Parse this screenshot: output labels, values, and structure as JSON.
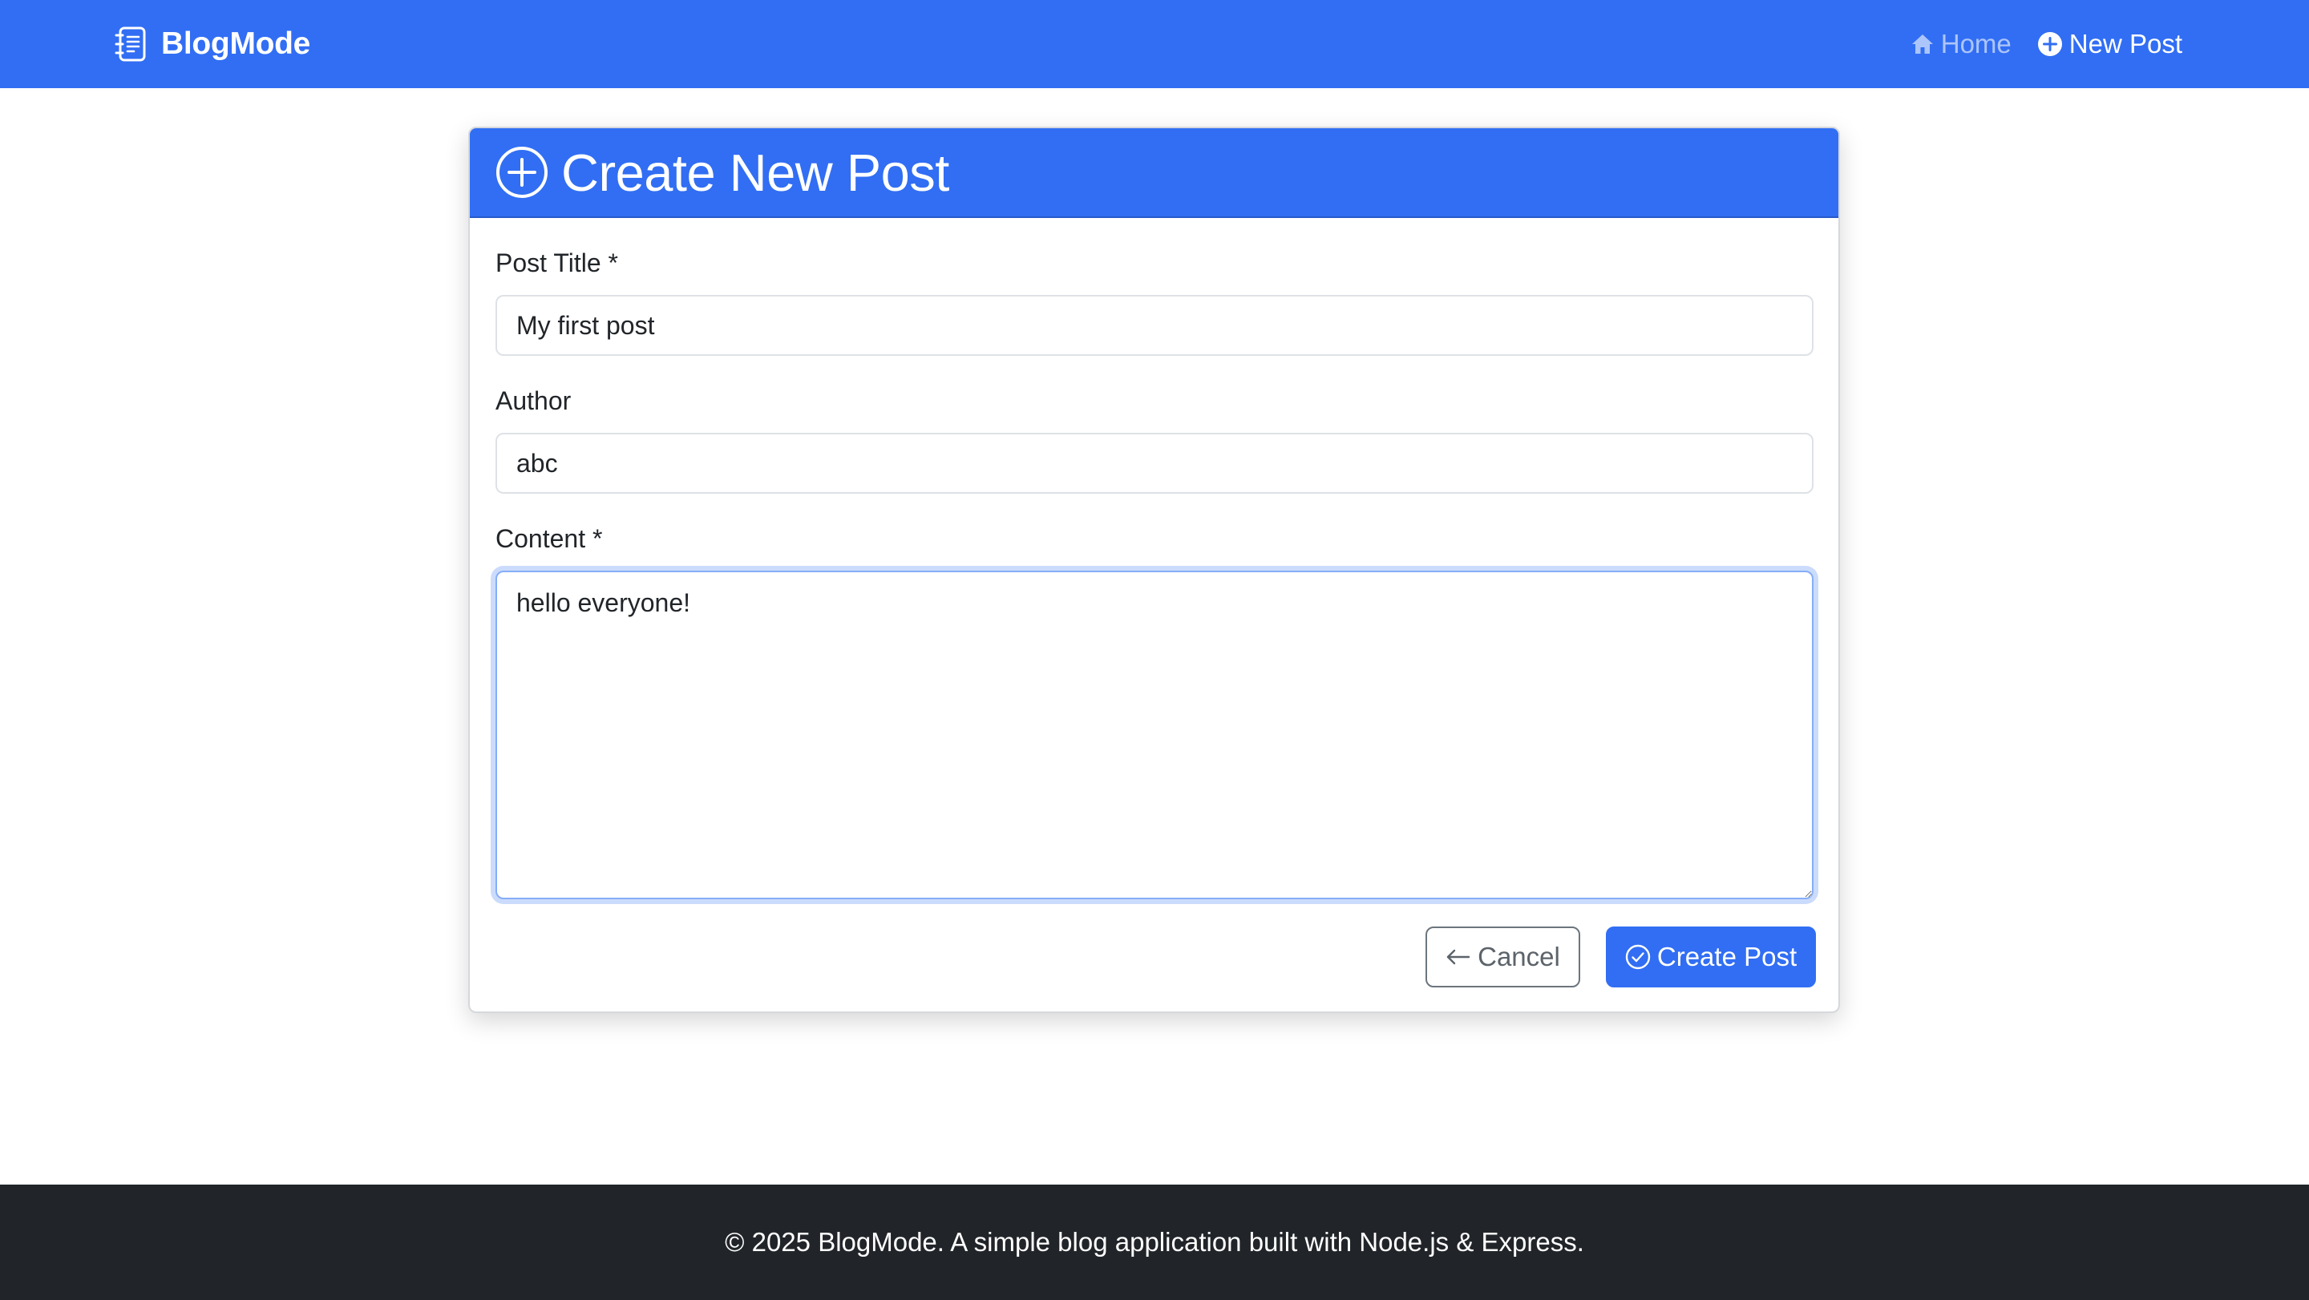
{
  "navbar": {
    "brand": "BlogMode",
    "brand_icon": "journal-text-icon",
    "links": [
      {
        "label": "Home",
        "icon": "house-icon",
        "active": false
      },
      {
        "label": "New Post",
        "icon": "plus-circle-fill-icon",
        "active": true
      }
    ]
  },
  "card": {
    "title": "Create New Post",
    "title_icon": "plus-circle-icon",
    "fields": {
      "title": {
        "label": "Post Title *",
        "value": "My first post"
      },
      "author": {
        "label": "Author",
        "value": "abc"
      },
      "content": {
        "label": "Content *",
        "value": "hello everyone!"
      }
    },
    "buttons": {
      "cancel": "Cancel",
      "create": "Create Post"
    }
  },
  "footer": {
    "text": "© 2025 BlogMode. A simple blog application built with Node.js & Express."
  },
  "colors": {
    "primary": "#316ef3",
    "footer_bg": "#212529",
    "secondary": "#6c757d"
  }
}
